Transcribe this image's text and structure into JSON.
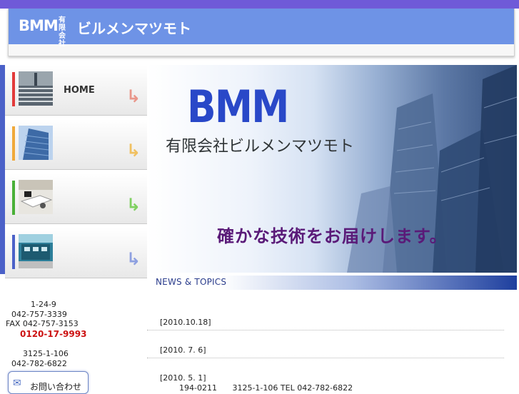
{
  "header": {
    "logo_bmm": "BMM",
    "logo_small": "有限会社",
    "logo_name": "ビルメンマツモト"
  },
  "nav": {
    "items": [
      {
        "label": "HOME",
        "stripe_color": "#e23a3a",
        "arrow_color": "#e9968a"
      },
      {
        "label": "",
        "stripe_color": "#f0a93a",
        "arrow_color": "#f0c060"
      },
      {
        "label": "",
        "stripe_color": "#49b038",
        "arrow_color": "#7fd060"
      },
      {
        "label": "",
        "stripe_color": "#4b61c8",
        "arrow_color": "#8ea0e0"
      }
    ]
  },
  "hero": {
    "bmm": "BMM",
    "company": "有限会社ビルメンマツモト",
    "tagline": "確かな技術をお届けします。"
  },
  "news": {
    "heading": "NEWS & TOPICS",
    "items": [
      {
        "date": "[2010.10.18]"
      },
      {
        "date": "[2010. 7. 6]"
      },
      {
        "date": "[2010. 5. 1]"
      }
    ],
    "detail_postal": "194-0211",
    "detail_address": "3125-1-106",
    "detail_tel": "TEL 042-782-6822"
  },
  "contact": {
    "address1": "1-24-9",
    "tel1": "042-757-3339",
    "fax1": "FAX 042-757-3153",
    "free_dial": "0120-17-9993",
    "address2": "3125-1-106",
    "tel2": "042-782-6822"
  },
  "inquiry": {
    "label": "お問い合わせ",
    "icon": "envelope-icon"
  }
}
